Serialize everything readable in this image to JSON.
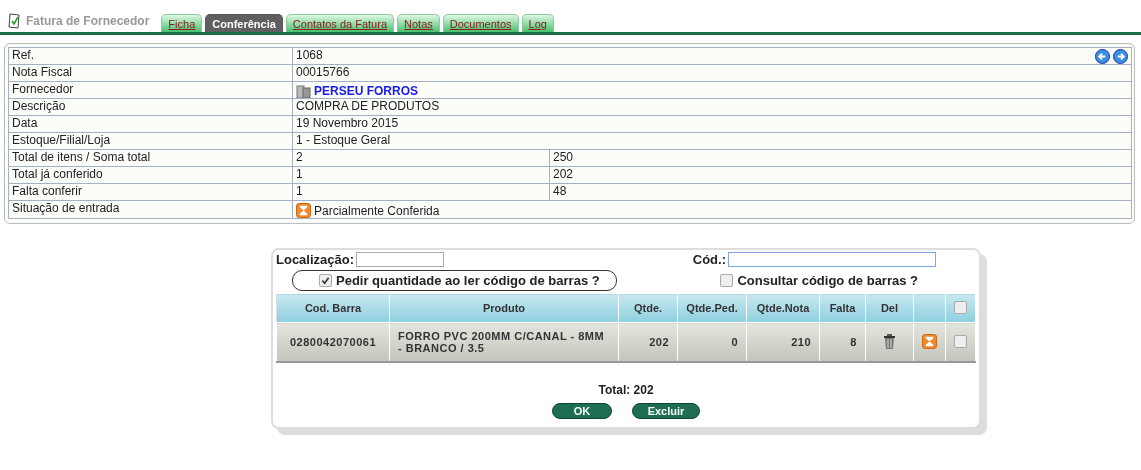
{
  "header": {
    "title": "Fatura de Fornecedor"
  },
  "tabs": [
    {
      "label": "Ficha",
      "selected": false
    },
    {
      "label": "Conferência",
      "selected": true
    },
    {
      "label": "Contatos da Fatura",
      "selected": false
    },
    {
      "label": "Notas",
      "selected": false
    },
    {
      "label": "Documentos",
      "selected": false
    },
    {
      "label": "Log",
      "selected": false
    }
  ],
  "info_rows": [
    {
      "kind": "text",
      "label": "Ref.",
      "values": [
        "1068"
      ]
    },
    {
      "kind": "text",
      "label": "Nota Fiscal",
      "values": [
        "00015766"
      ]
    },
    {
      "kind": "supplier",
      "label": "Fornecedor",
      "values": [
        "PERSEU FORROS"
      ]
    },
    {
      "kind": "text",
      "label": "Descrição",
      "values": [
        "COMPRA DE PRODUTOS"
      ]
    },
    {
      "kind": "text",
      "label": "Data",
      "values": [
        "19 Novembro 2015"
      ]
    },
    {
      "kind": "text",
      "label": "Estoque/Filial/Loja",
      "values": [
        "1 - Estoque Geral"
      ]
    },
    {
      "kind": "text",
      "label": "Total de itens / Soma total",
      "values": [
        "2",
        "250"
      ]
    },
    {
      "kind": "text",
      "label": "Total já conferido",
      "values": [
        "1",
        "202"
      ]
    },
    {
      "kind": "text",
      "label": "Falta conferir",
      "values": [
        "1",
        "48"
      ]
    },
    {
      "kind": "status",
      "label": "Situação de entrada",
      "values": [
        "Parcialmente Conferida"
      ]
    }
  ],
  "check_panel": {
    "location_label": "Localização:",
    "code_label": "Cód.:",
    "ask_quantity": {
      "label": "Pedir quantidade ao ler código de barras ?",
      "checked": true
    },
    "lookup_barcode": {
      "label": "Consultar código de barras ?",
      "checked": false
    },
    "columns": [
      "Cod. Barra",
      "Produto",
      "Qtde.",
      "Qtde.Ped.",
      "Qtde.Nota",
      "Falta",
      "Del"
    ],
    "select_all": {
      "checked": false
    },
    "rows": [
      {
        "barcode": "0280042070061",
        "product": "FORRO PVC 200MM C/CANAL - 8MM - BRANCO / 3.5",
        "qty": "202",
        "qty_ordered": "0",
        "qty_invoice": "210",
        "missing": "8",
        "checked": false
      }
    ],
    "total": "Total: 202",
    "buttons": [
      "OK",
      "Excluir"
    ]
  }
}
